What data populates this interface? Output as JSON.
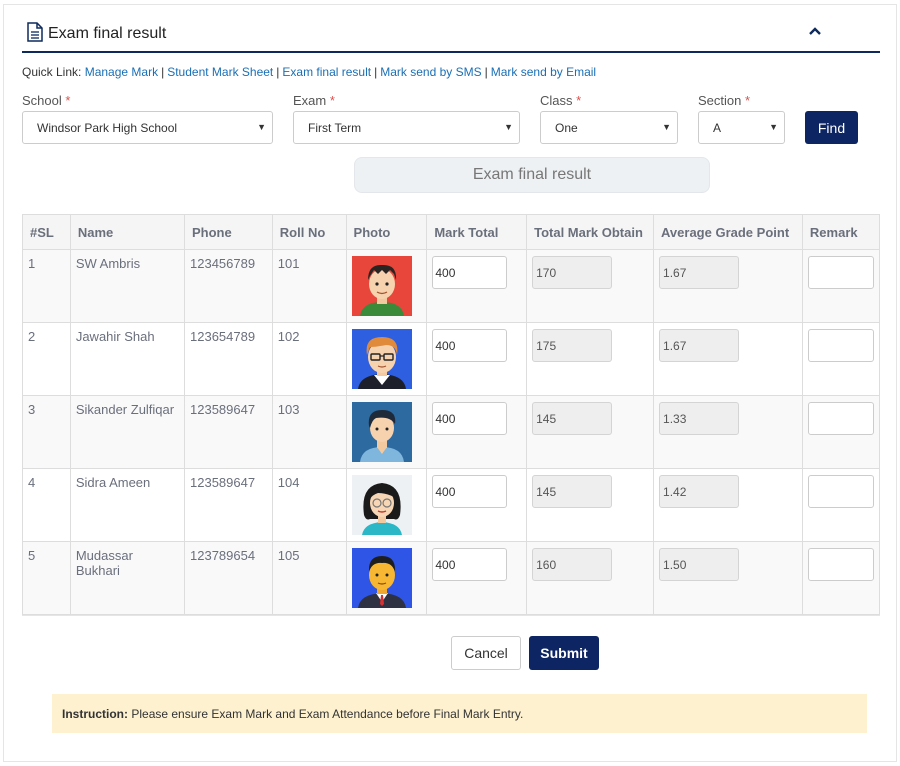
{
  "header": {
    "title": "Exam final result"
  },
  "quick_links": {
    "prefix": "Quick Link:",
    "links": [
      "Manage Mark",
      "Student Mark Sheet",
      "Exam final result",
      "Mark send by SMS",
      "Mark send by Email"
    ]
  },
  "filters": {
    "school": {
      "label": "School",
      "required_mark": "*",
      "value": "Windsor Park High School"
    },
    "exam": {
      "label": "Exam",
      "required_mark": "*",
      "value": "First Term"
    },
    "class": {
      "label": "Class",
      "required_mark": "*",
      "value": "One"
    },
    "section": {
      "label": "Section",
      "required_mark": "*",
      "value": "A"
    },
    "find_label": "Find"
  },
  "result_title": "Exam final result",
  "table": {
    "columns": [
      "#SL",
      "Name",
      "Phone",
      "Roll No",
      "Photo",
      "Mark Total",
      "Total Mark Obtain",
      "Average Grade Point",
      "Remark"
    ],
    "rows": [
      {
        "sl": "1",
        "name": "SW Ambris",
        "phone": "123456789",
        "roll": "101",
        "mark_total": "400",
        "obtain": "170",
        "gpa": "1.67",
        "remark": "",
        "avatar": "boy-avatar"
      },
      {
        "sl": "2",
        "name": "Jawahir Shah",
        "phone": "123654789",
        "roll": "102",
        "mark_total": "400",
        "obtain": "175",
        "gpa": "1.67",
        "remark": "",
        "avatar": "glasses-man-avatar"
      },
      {
        "sl": "3",
        "name": "Sikander Zulfiqar",
        "phone": "123589647",
        "roll": "103",
        "mark_total": "400",
        "obtain": "145",
        "gpa": "1.33",
        "remark": "",
        "avatar": "man-avatar"
      },
      {
        "sl": "4",
        "name": "Sidra Ameen",
        "phone": "123589647",
        "roll": "104",
        "mark_total": "400",
        "obtain": "145",
        "gpa": "1.42",
        "remark": "",
        "avatar": "woman-avatar"
      },
      {
        "sl": "5",
        "name": "Mudassar Bukhari",
        "phone": "123789654",
        "roll": "105",
        "mark_total": "400",
        "obtain": "160",
        "gpa": "1.50",
        "remark": "",
        "avatar": "businessman-avatar"
      }
    ]
  },
  "actions": {
    "cancel_label": "Cancel",
    "submit_label": "Submit"
  },
  "instruction": {
    "label": "Instruction:",
    "text": "Please ensure Exam Mark and Exam Attendance before Final Mark Entry."
  },
  "colors": {
    "primary": "#0d2562",
    "link": "#1a6fb5",
    "required": "#d9534f",
    "instruction_bg": "#fdf1d0"
  }
}
